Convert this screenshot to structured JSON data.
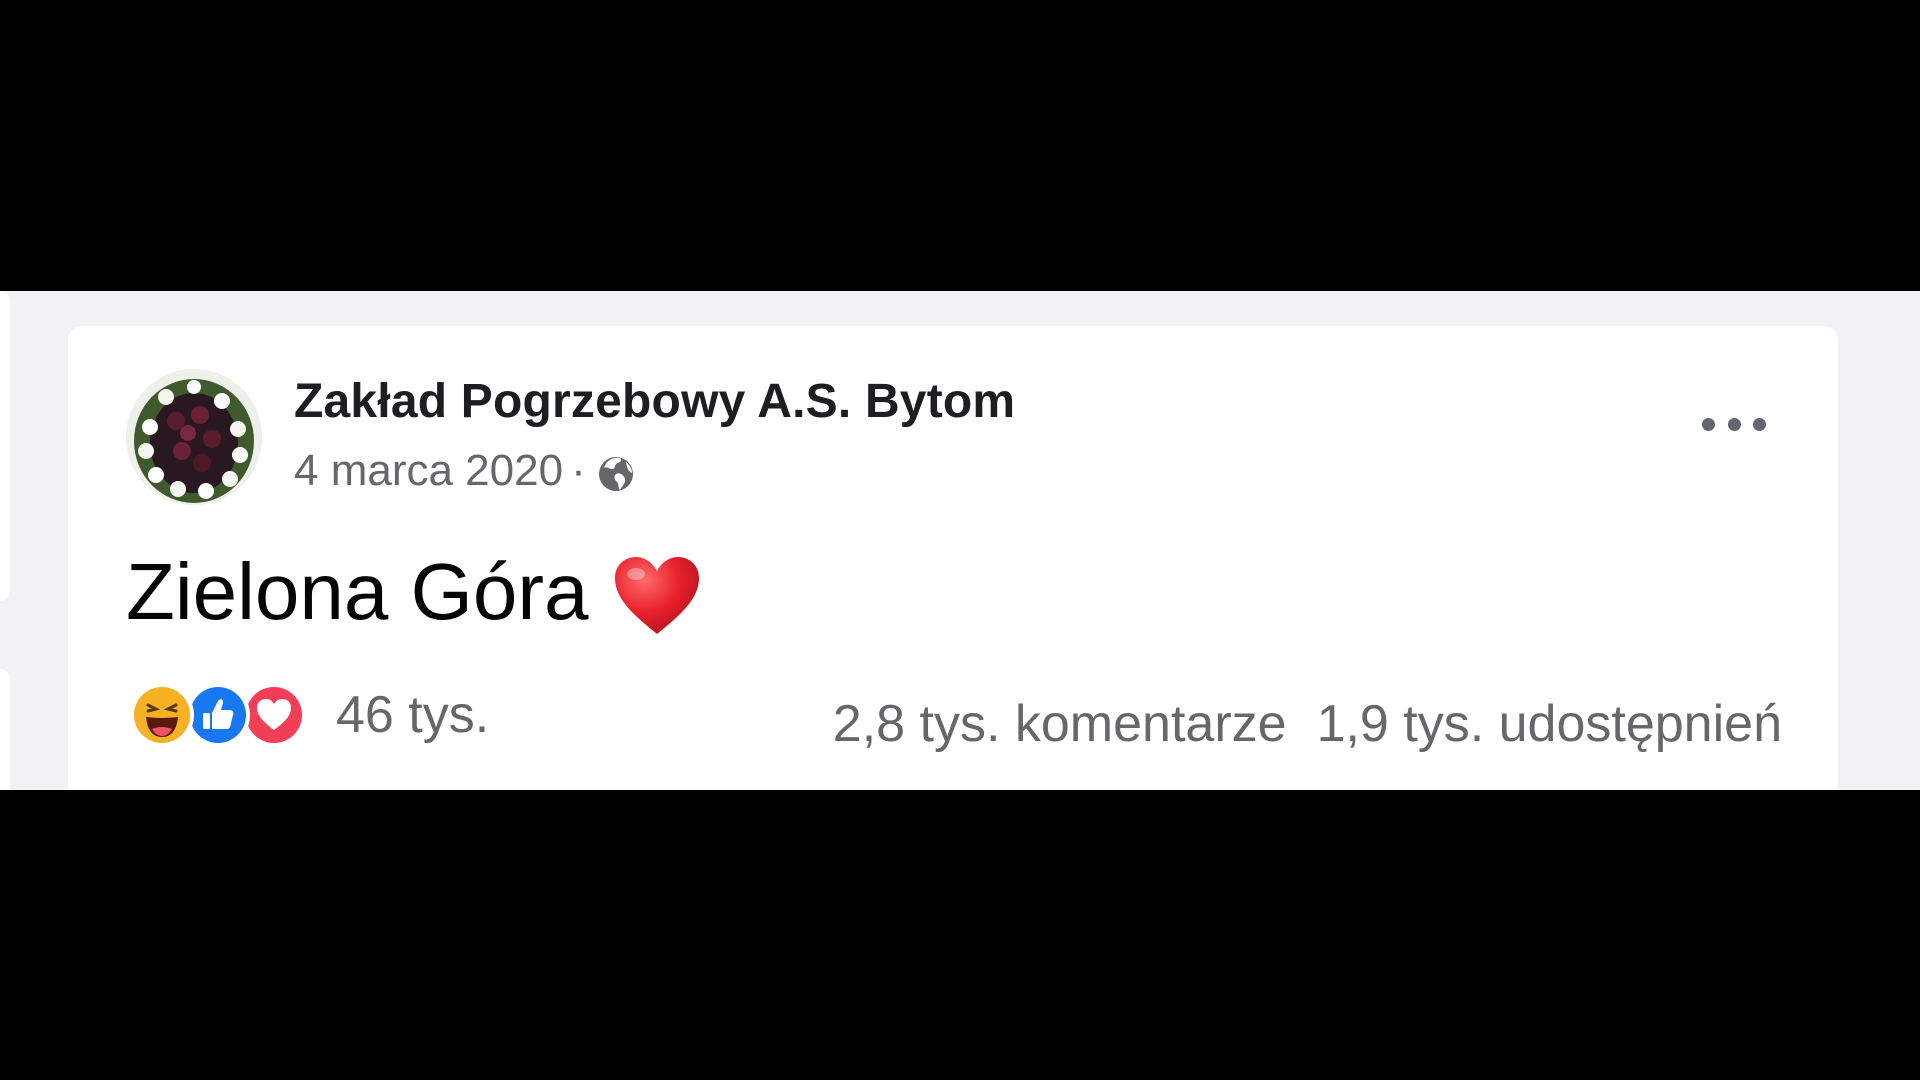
{
  "post": {
    "author": "Zakład Pogrzebowy A.S. Bytom",
    "date": "4 marca 2020",
    "separator": "·",
    "privacy_icon": "globe-icon",
    "text": "Zielona Góra",
    "text_emoji": "heart-emoji",
    "reactions": {
      "icons": [
        "haha-icon",
        "like-icon",
        "love-icon"
      ],
      "count": "46 tys."
    },
    "comments": "2,8 tys. komentarze",
    "shares": "1,9 tys. udostępnień"
  },
  "colors": {
    "background": "#000000",
    "feed": "#f0f2f5",
    "card": "#ffffff",
    "like_blue": "#1877f2",
    "love_red": "#f33e58",
    "haha_yellow": "#f7b125",
    "secondary_text": "#65676b"
  }
}
